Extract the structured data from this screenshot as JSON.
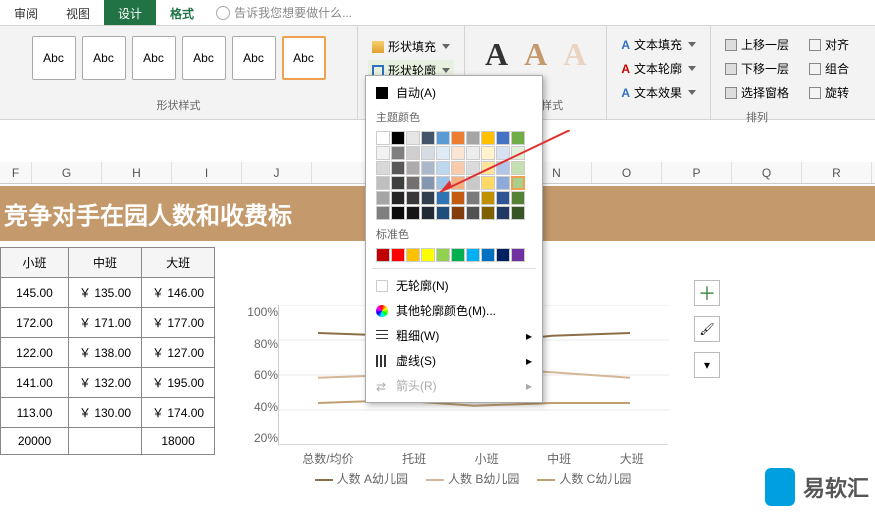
{
  "tabs": {
    "review": "审阅",
    "view": "视图",
    "design": "设计",
    "format": "格式",
    "tell": "告诉我您想要做什么..."
  },
  "ribbon": {
    "gallery": [
      "Abc",
      "Abc",
      "Abc",
      "Abc",
      "Abc",
      "Abc"
    ],
    "shape_style_label": "形状样式",
    "fill": "形状填充",
    "outline": "形状轮廓",
    "auto": "自动(A)",
    "theme": "主题颜色",
    "standard": "标准色",
    "no_outline": "无轮廓(N)",
    "more": "其他轮廓颜色(M)...",
    "weight": "粗细(W)",
    "dash": "虚线(S)",
    "arrows": "箭头(R)",
    "wordart_label": "艺术字样式",
    "text_fill": "文本填充",
    "text_outline": "文本轮廓",
    "text_fx": "文本效果",
    "bring_fwd": "上移一层",
    "send_back": "下移一层",
    "sel_pane": "选择窗格",
    "align": "对齐",
    "group": "组合",
    "rotate": "旋转",
    "arrange_label": "排列"
  },
  "cols": [
    "F",
    "G",
    "H",
    "I",
    "J",
    "N",
    "O",
    "P",
    "Q",
    "R"
  ],
  "banner": "竞争对手在园人数和收费标",
  "tbl": {
    "hdr": [
      "小班",
      "中班",
      "大班"
    ],
    "rows": [
      [
        "145.00",
        "￥ 135.00",
        "￥ 146.00"
      ],
      [
        "172.00",
        "￥ 171.00",
        "￥ 177.00"
      ],
      [
        "122.00",
        "￥ 138.00",
        "￥ 127.00"
      ],
      [
        "141.00",
        "￥ 132.00",
        "￥ 195.00"
      ],
      [
        "113.00",
        "￥ 130.00",
        "￥ 174.00"
      ],
      [
        "20000",
        "",
        "18000"
      ]
    ]
  },
  "chart_data": {
    "type": "line",
    "title": "",
    "ylabel": "",
    "xlabel": "",
    "ylim": [
      0,
      100
    ],
    "yticks": [
      "100%",
      "80%",
      "60%",
      "40%",
      "20%"
    ],
    "categories": [
      "总数/均价",
      "托班",
      "小班",
      "中班",
      "大班"
    ],
    "series": [
      {
        "name": "人数 A幼儿园",
        "color": "#8b6f47",
        "values": [
          80,
          78,
          72,
          78,
          80
        ]
      },
      {
        "name": "人数 B幼儿园",
        "color": "#d4b896",
        "values": [
          48,
          50,
          55,
          52,
          48
        ]
      },
      {
        "name": "人数 C幼儿园",
        "color": "#c0a070",
        "values": [
          30,
          32,
          28,
          30,
          30
        ]
      }
    ],
    "legend": [
      "人数 A幼儿园",
      "人数 B幼儿园",
      "人数 C幼儿园"
    ]
  },
  "theme_colors": [
    [
      "#ffffff",
      "#000000",
      "#e7e6e6",
      "#44546a",
      "#5b9bd5",
      "#ed7d31",
      "#a5a5a5",
      "#ffc000",
      "#4472c4",
      "#70ad47"
    ],
    [
      "#f2f2f2",
      "#7f7f7f",
      "#d0cece",
      "#d6dce4",
      "#deebf6",
      "#fbe5d5",
      "#ededed",
      "#fff2cc",
      "#d9e2f3",
      "#e2efd9"
    ],
    [
      "#d8d8d8",
      "#595959",
      "#aeabab",
      "#adb9ca",
      "#bdd7ee",
      "#f7cbac",
      "#dbdbdb",
      "#fee599",
      "#b4c6e7",
      "#c5e0b3"
    ],
    [
      "#bfbfbf",
      "#3f3f3f",
      "#757070",
      "#8496b0",
      "#9cc3e5",
      "#f4b183",
      "#c9c9c9",
      "#ffd965",
      "#8eaadb",
      "#a8d08d"
    ],
    [
      "#a5a5a5",
      "#262626",
      "#3a3838",
      "#323f4f",
      "#2e75b5",
      "#c55a11",
      "#7b7b7b",
      "#bf9000",
      "#2f5496",
      "#538135"
    ],
    [
      "#7f7f7f",
      "#0c0c0c",
      "#171616",
      "#222a35",
      "#1e4e79",
      "#833c0b",
      "#525252",
      "#7f6000",
      "#1f3864",
      "#375623"
    ]
  ],
  "std_colors": [
    "#c00000",
    "#ff0000",
    "#ffc000",
    "#ffff00",
    "#92d050",
    "#00b050",
    "#00b0f0",
    "#0070c0",
    "#002060",
    "#7030a0"
  ],
  "selected_color": [
    3,
    9
  ],
  "watermark": "易软汇"
}
